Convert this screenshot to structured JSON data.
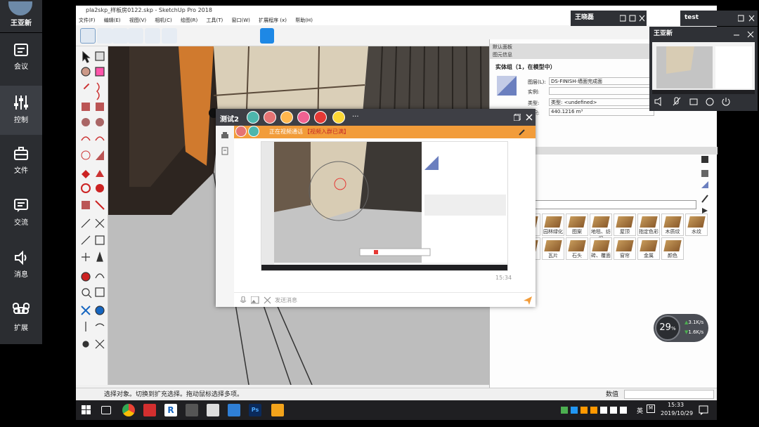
{
  "sidebar": {
    "user_name": "王亚新",
    "items": [
      {
        "label": "会议",
        "icon": "meeting-icon"
      },
      {
        "label": "控制",
        "icon": "control-sliders-icon"
      },
      {
        "label": "文件",
        "icon": "briefcase-icon"
      },
      {
        "label": "交流",
        "icon": "chat-icon"
      },
      {
        "label": "消息",
        "icon": "speaker-icon"
      },
      {
        "label": "扩展",
        "icon": "command-icon"
      }
    ]
  },
  "sketchup": {
    "title": "pla2skp_样板房0122.skp - SketchUp Pro 2018",
    "menu": [
      "文件(F)",
      "编辑(E)",
      "视图(V)",
      "相机(C)",
      "绘图(R)",
      "工具(T)",
      "窗口(W)",
      "扩展程序 (x)",
      "帮助(H)"
    ],
    "status": "选择对象。切换到扩充选择。拖动鼠标选择多项。",
    "measure_label": "数值"
  },
  "tray_panel": {
    "default_panel": "默认面板",
    "entity_info": "图元信息",
    "entity_title": "实体组（1，在模型中）",
    "layer_label": "图层(L):",
    "layer_value": "DS-FINISH-墙面完成面",
    "instance_label": "实例:",
    "type_label": "类型:",
    "type_value": "类型: <undefined>",
    "volume_label": "体积:",
    "volume_value": "440.1216 m³",
    "materials_row1": [
      "",
      "园林绿化",
      "图案",
      "地毯、纺织",
      "屋顶",
      "指定色彩",
      "木质纹",
      "水纹"
    ],
    "materials_row2": [
      "",
      "瓦片",
      "石头",
      "砖、覆面",
      "窗帘",
      "金属",
      "颜色"
    ]
  },
  "chat": {
    "title": "测试2",
    "more": "···",
    "tooltip_close": "关闭",
    "banner_prefix": "正在视频通话",
    "banner_link": "【视频入群已满】",
    "time": "15:34",
    "input_placeholder": "发送消息"
  },
  "video_panels": {
    "panel1_title": "王晓磊",
    "panel2_title": "test",
    "panel3_title": "王亚新"
  },
  "gauge": {
    "percent": "29",
    "unit": "%",
    "up_speed": "3.1",
    "down_speed": "1.6",
    "speed_unit": "K/s"
  },
  "taskbar": {
    "lang": "英",
    "time": "15:33",
    "date": "2019/10/29"
  },
  "colors": {
    "accent_orange": "#f29c3a",
    "sidebar_bg": "#2b2d31",
    "chat_head": "#3e3f45"
  }
}
